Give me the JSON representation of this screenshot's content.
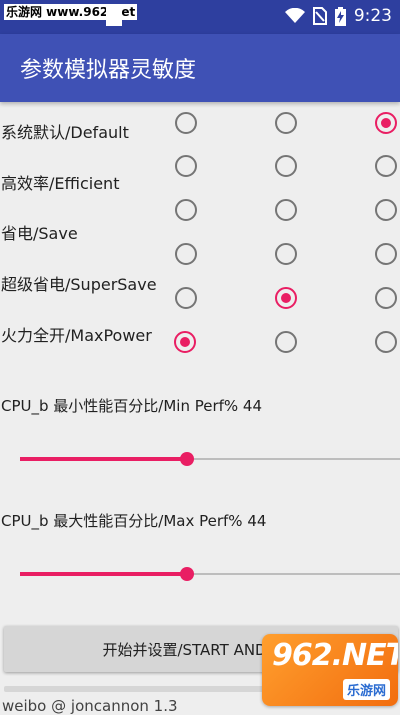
{
  "status_bar": {
    "watermark": "乐游网 www.962.net",
    "time": "9:23",
    "icons": [
      "wifi-icon",
      "no-sim-icon",
      "battery-charging-icon"
    ]
  },
  "app_bar": {
    "title": "参数模拟器灵敏度"
  },
  "profiles": [
    {
      "label": "系统默认/Default",
      "selected_column": 3
    },
    {
      "label": "高效率/Efficient",
      "selected_column": 0
    },
    {
      "label": "省电/Save",
      "selected_column": 0
    },
    {
      "label": "超级省电/SuperSave",
      "selected_column": 2
    },
    {
      "label": "火力全开/MaxPower",
      "selected_column": 1
    }
  ],
  "sliders": [
    {
      "label": "CPU_b 最小性能百分比/Min Perf% 44",
      "value_percent": 44
    },
    {
      "label": "CPU_b 最大性能百分比/Max Perf% 44",
      "value_percent": 44
    }
  ],
  "start_button": {
    "label": "开始并设置/START AND SET"
  },
  "footer": {
    "text": "weibo @ joncannon 1.3"
  },
  "logo": {
    "main": "962.NET",
    "sub": "乐游网"
  },
  "colors": {
    "primary": "#3f51b5",
    "primary_dark": "#2e3f9f",
    "accent": "#e91e63"
  }
}
